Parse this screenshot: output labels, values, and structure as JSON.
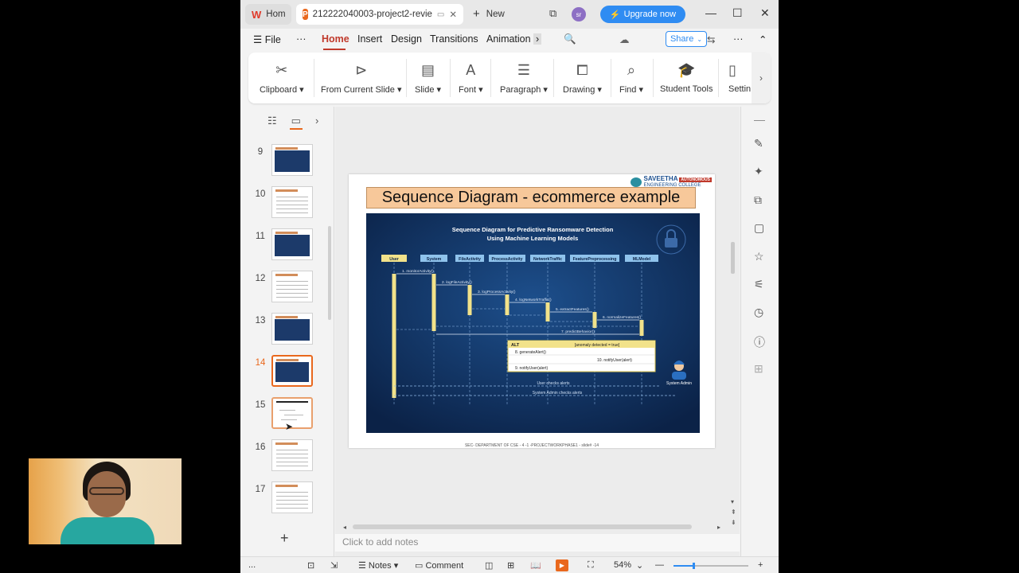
{
  "titlebar": {
    "home_tab": "Hom",
    "doc_tab": "212222040003-project2-revie",
    "new_tab": "New",
    "avatar_initials": "sr",
    "upgrade_label": "Upgrade now"
  },
  "menubar": {
    "file": "File",
    "items": [
      "Home",
      "Insert",
      "Design",
      "Transitions",
      "Animation"
    ],
    "share": "Share"
  },
  "ribbon": {
    "groups": [
      "Clipboard",
      "From Current Slide",
      "Slide",
      "Font",
      "Paragraph",
      "Drawing",
      "Find",
      "Student Tools",
      "Settin"
    ]
  },
  "slides_panel": {
    "numbers": [
      "9",
      "10",
      "11",
      "12",
      "13",
      "14",
      "15",
      "16",
      "17"
    ],
    "selected": "14"
  },
  "slide": {
    "college_name": "SAVEETHA",
    "college_badge": "AUTONOMOUS",
    "college_sub": "ENGINEERING COLLEGE",
    "title": "Sequence Diagram - ecommerce example",
    "diagram_title_1": "Sequence Diagram for Predictive Ransomware Detection",
    "diagram_title_2": "Using Machine Learning Models",
    "lifelines": [
      "User",
      "System",
      "FileActivity",
      "ProcessActivity",
      "NetworkTraffic",
      "FeaturePreprocessing",
      "MLModel"
    ],
    "messages": [
      "1. monitorActivity()",
      "2. logFileActivity()",
      "3. logProcessActivity()",
      "4. logNetworkTraffic()",
      "5. extractFeatures()",
      "6. normalizeFeatures()",
      "7. predictBehavior()"
    ],
    "alt_label": "ALT",
    "alt_condition": "[anomaly detected = true]",
    "alt_messages": [
      "8. generateAlert()",
      "10. notifyUser(alert)",
      "9. notifyUser(alert)"
    ],
    "bottom_messages": [
      "User checks alerts",
      "System Admin checks alerts"
    ],
    "admin_label": "System Admin",
    "footer": "SEC- DEPARTMENT OF CSE - 4 -1 -PROJECTWORKPHASE1 - slide# -14"
  },
  "notes_placeholder": "Click to add notes",
  "statusbar": {
    "dots": "...",
    "notes": "Notes",
    "comment": "Comment",
    "zoom": "54%",
    "zoom_level": 0.54
  },
  "colors": {
    "accent": "#e9681d",
    "tab_active": "#c0392b",
    "upgrade": "#2f8cf2",
    "diagram_bg": "#0f2d5a"
  }
}
